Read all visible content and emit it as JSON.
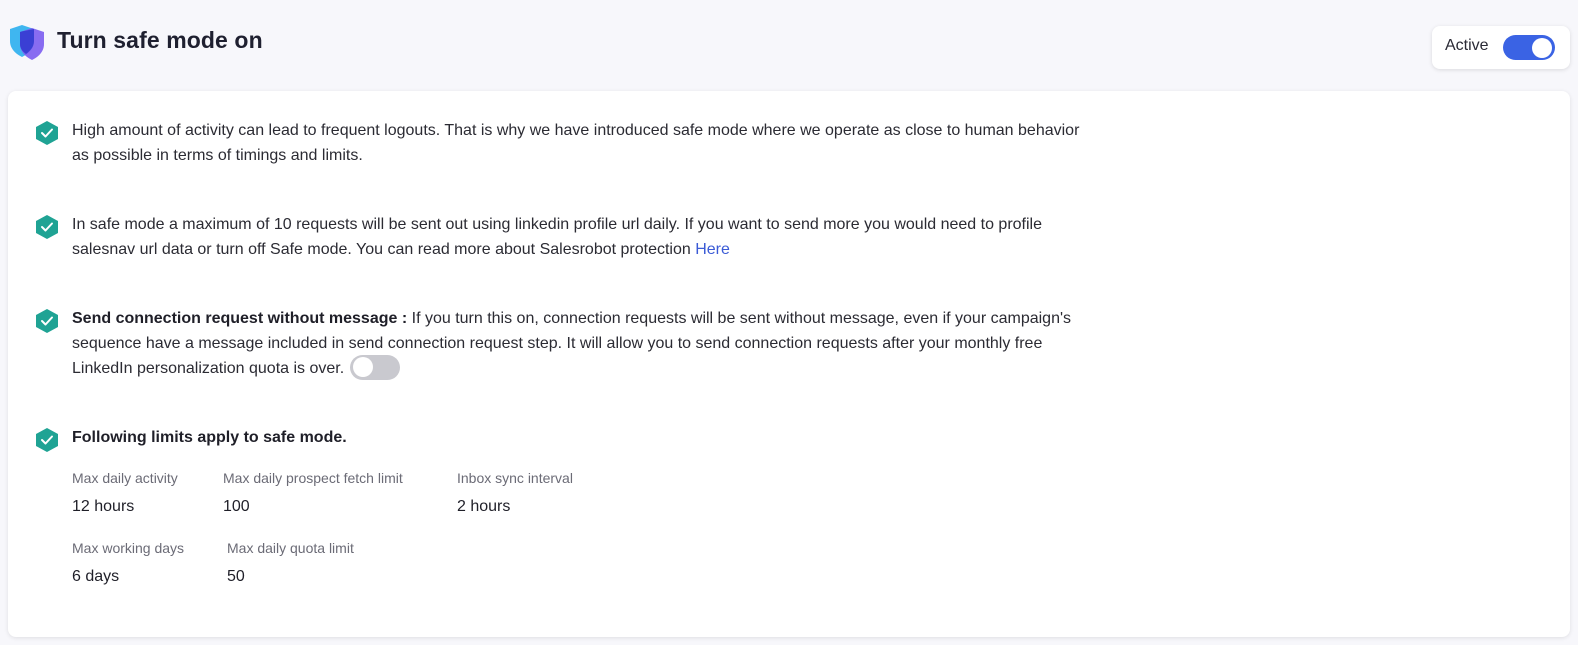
{
  "header": {
    "title": "Turn safe mode on",
    "status_label": "Active",
    "status_toggle_on": true
  },
  "colors": {
    "accent": "#3a63e4",
    "check": "#1fa394",
    "link": "#3b5bd6",
    "shield_light": "#3fb6f0",
    "shield_dark": "#7b5cf0"
  },
  "items": [
    {
      "text": "High amount of activity can lead to frequent logouts. That is why we have introduced safe mode where we operate as close to human behavior as possible in terms of timings and limits."
    },
    {
      "text": "In safe mode a maximum of 10 requests will be sent out using linkedin profile url daily. If you want to send more you would need to profile salesnav url data or turn off Safe mode. You can read more about Salesrobot protection ",
      "link": "Here"
    },
    {
      "bold": "Send connection request without message :",
      "text": " If you turn this on, connection requests will be sent without message, even if your campaign's sequence have a message included in send connection request step. It will allow you to send connection requests after your monthly free LinkedIn personalization quota is over.",
      "toggle_on": false
    },
    {
      "bold": "Following limits apply to safe mode."
    }
  ],
  "limits": [
    {
      "label": "Max daily activity",
      "value": "12 hours"
    },
    {
      "label": "Max daily prospect fetch limit",
      "value": "100"
    },
    {
      "label": "Inbox sync interval",
      "value": "2 hours"
    },
    {
      "label": "Max working days",
      "value": "6 days"
    },
    {
      "label": "Max daily quota limit",
      "value": "50"
    }
  ]
}
